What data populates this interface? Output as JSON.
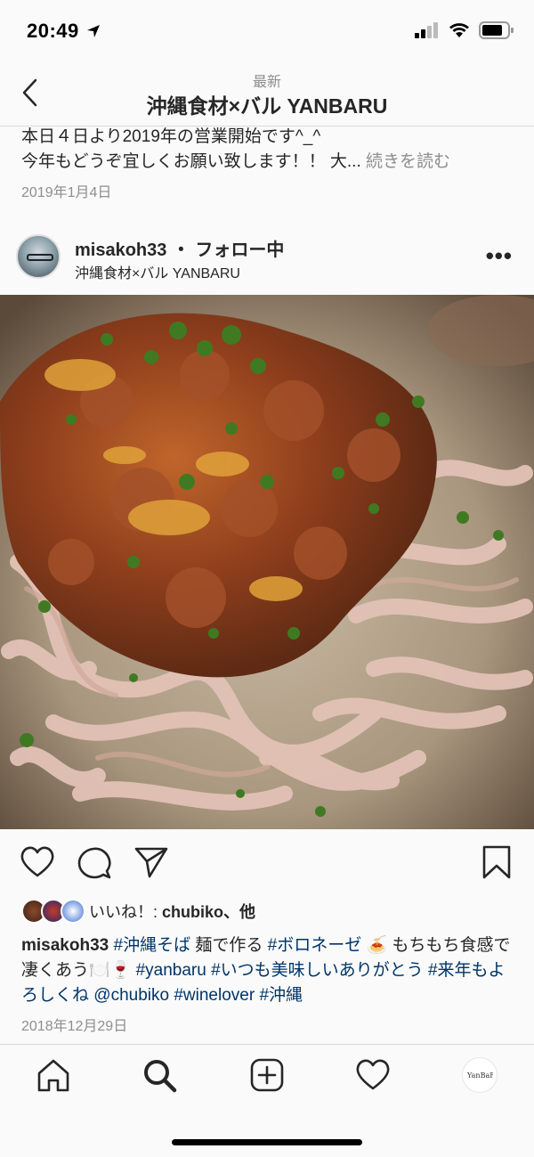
{
  "status_bar": {
    "time": "20:49"
  },
  "header": {
    "subtitle": "最新",
    "title": "沖縄食材×バル YANBARU"
  },
  "previous_post": {
    "caption_line1": "本日４日より2019年の営業開始です^_^",
    "caption_line2": "今年もどうぞ宜しくお願い致します！！ 大...",
    "more_label": "続きを読む",
    "date": "2019年1月4日"
  },
  "post": {
    "username": "misakoh33",
    "separator": "・",
    "follow_status": "フォロー中",
    "location": "沖縄食材×バル YANBARU",
    "more": "•••",
    "likes_prefix": "いいね！: ",
    "likes_user": "chubiko",
    "likes_suffix": "、他",
    "caption": {
      "username": "misakoh33",
      "t1": "#沖縄そば",
      "p1": " 麺で作る ",
      "t2": "#ボロネーゼ",
      "p2": " 🍝 もちもち食感で凄くあう🍽️🍷 ",
      "t3": "#yanbaru",
      "p3": " ",
      "t4": "#いつも美味しいありがとう",
      "p4": " ",
      "t5": "#来年もよろしくね",
      "p5": " ",
      "t6": "@chubiko",
      "p6": " ",
      "t7": "#winelover",
      "p7": " ",
      "t8": "#沖縄"
    },
    "date": "2018年12月29日"
  },
  "tab_bar": {
    "items": [
      {
        "icon": "home-icon"
      },
      {
        "icon": "search-icon"
      },
      {
        "icon": "new-post-icon"
      },
      {
        "icon": "activity-heart-icon"
      },
      {
        "icon": "profile-avatar-icon"
      }
    ],
    "profile_label": "YanBaRu"
  }
}
